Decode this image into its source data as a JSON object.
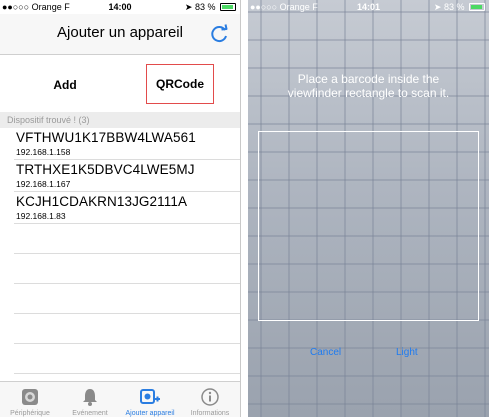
{
  "left": {
    "status": {
      "carrier": "●●○○○ Orange F",
      "time": "14:00",
      "battery": "83 %"
    },
    "nav": {
      "title": "Ajouter un appareil",
      "refresh_icon": "refresh-icon"
    },
    "segments": {
      "add": "Add",
      "qrcode": "QRCode"
    },
    "section_header": "Dispositif trouvé ! (3)",
    "devices": [
      {
        "id": "VFTHWU1K17BBW4LWA561",
        "ip": "192.168.1.158"
      },
      {
        "id": "TRTHXE1K5DBVC4LWE5MJ",
        "ip": "192.168.1.167"
      },
      {
        "id": "KCJH1CDAKRN13JG2111A",
        "ip": "192.168.1.83"
      }
    ],
    "tabs": [
      {
        "label": "Périphérique",
        "icon": "device-icon"
      },
      {
        "label": "Evénement",
        "icon": "bell-icon"
      },
      {
        "label": "Ajouter appareil",
        "icon": "add-device-icon"
      },
      {
        "label": "Informations",
        "icon": "info-icon"
      }
    ]
  },
  "right": {
    "status": {
      "carrier": "●●○○○ Orange F",
      "time": "14:01",
      "battery": "83 %"
    },
    "prompt_line1": "Place a barcode inside the",
    "prompt_line2": "viewfinder rectangle to scan it.",
    "cancel": "Cancel",
    "light": "Light"
  },
  "colors": {
    "accent": "#2a7de1",
    "qr_border": "#e24b4b",
    "battery": "#4cd964"
  }
}
